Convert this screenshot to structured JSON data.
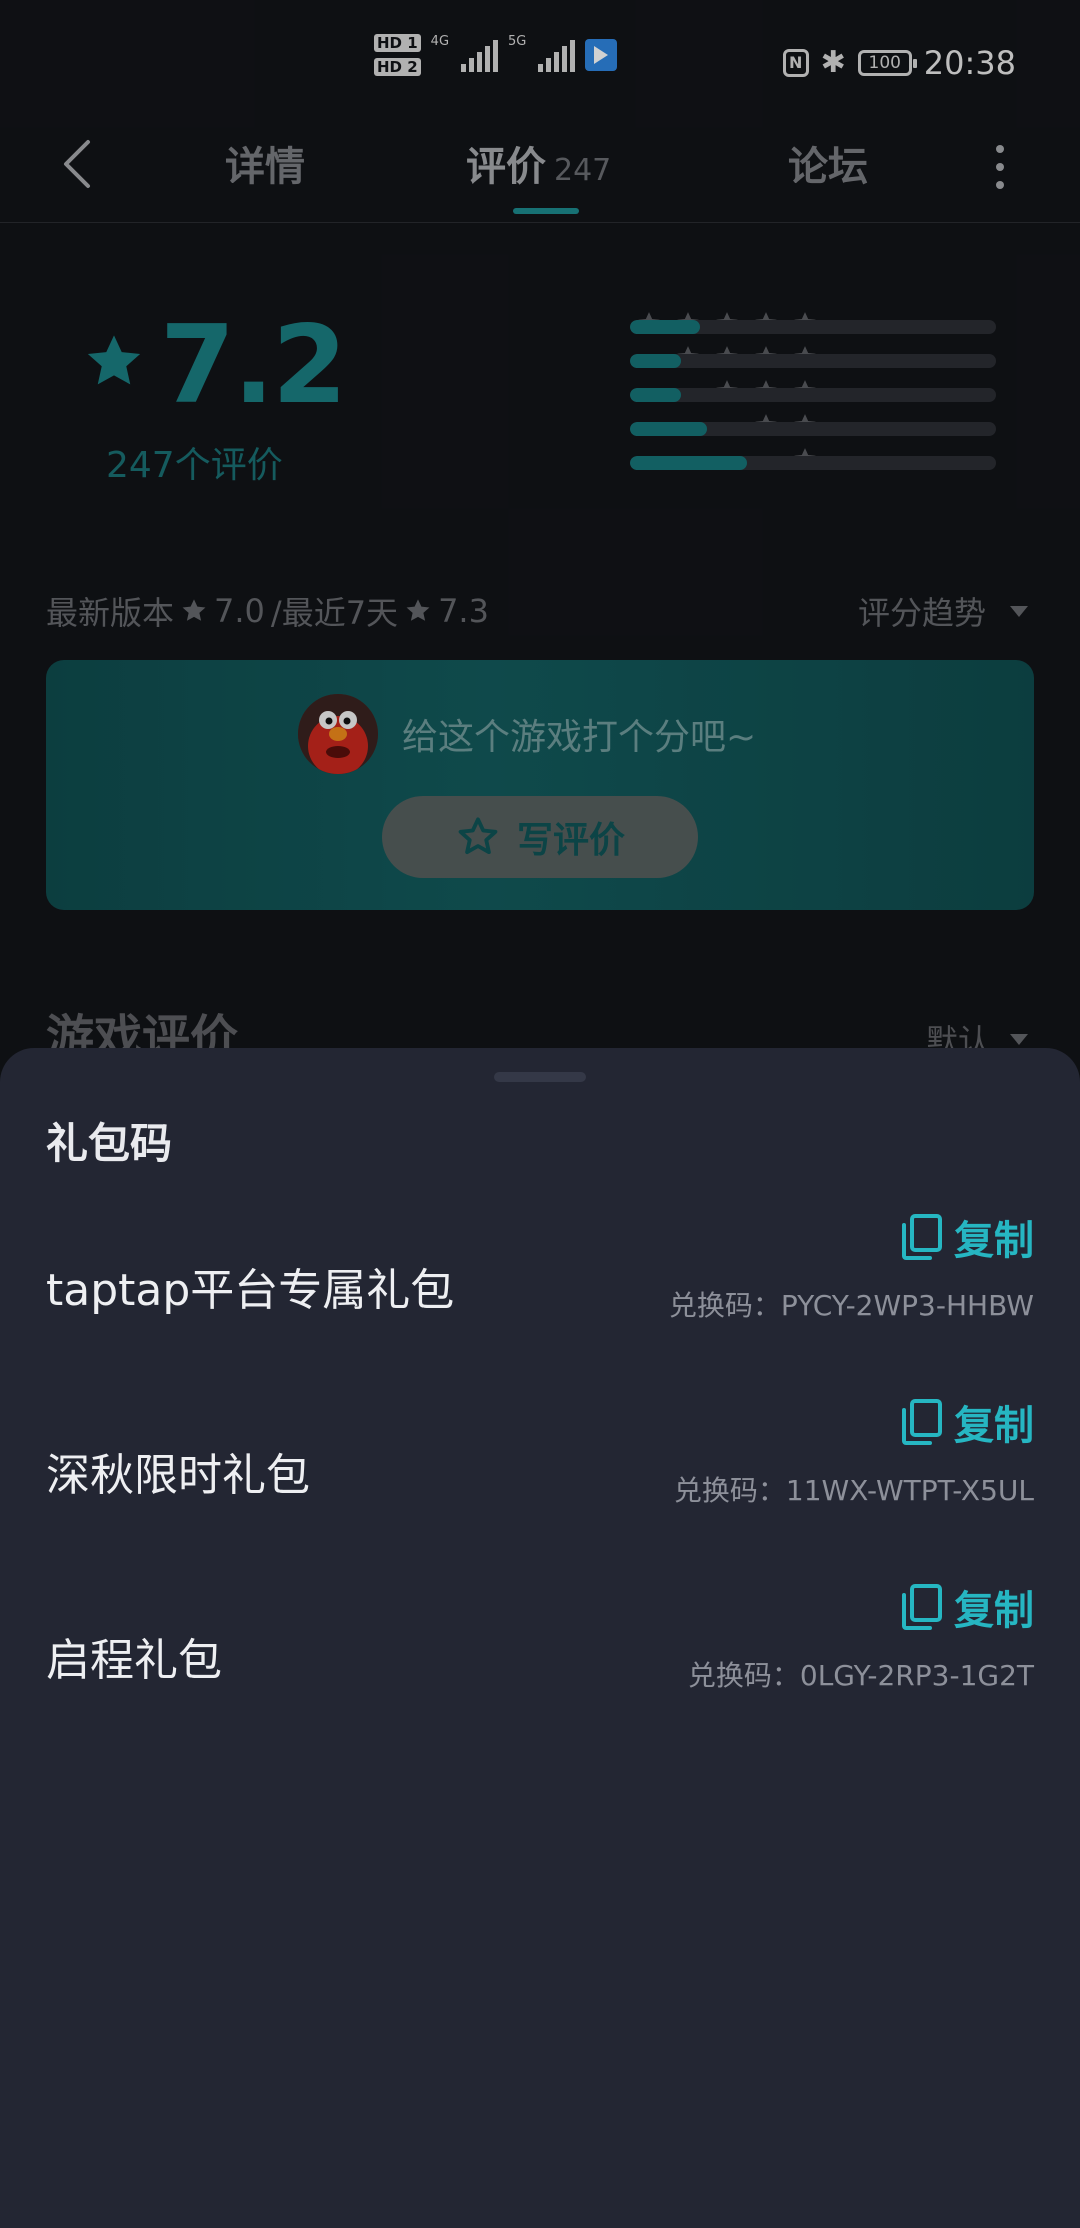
{
  "status_bar": {
    "sim1": "HD 1",
    "sim2": "HD 2",
    "net1": "4G",
    "net2": "5G",
    "nfc_icon": "N",
    "bluetooth_icon": "✱",
    "battery": "100",
    "time": "20:38"
  },
  "tabs": {
    "detail": "详情",
    "review": "评价",
    "review_count": "247",
    "forum": "论坛"
  },
  "rating": {
    "score": "7.2",
    "count_label": "247个评价",
    "distribution": [
      {
        "stars": 5,
        "fraction": 0.19
      },
      {
        "stars": 4,
        "fraction": 0.14
      },
      {
        "stars": 3,
        "fraction": 0.14
      },
      {
        "stars": 2,
        "fraction": 0.21
      },
      {
        "stars": 1,
        "fraction": 0.32
      }
    ]
  },
  "version": {
    "latest_label": "最新版本",
    "latest_score": "7.0",
    "recent_label": "/最近7天",
    "recent_score": "7.3",
    "trend_label": "评分趋势"
  },
  "write_card": {
    "prompt": "给这个游戏打个分吧~",
    "button": "写评价"
  },
  "reviews": {
    "title": "游戏评价",
    "sort": "默认"
  },
  "gift_sheet": {
    "title": "礼包码",
    "copy_label": "复制",
    "items": [
      {
        "name": "taptap平台专属礼包",
        "code": "兑换码：PYCY-2WP3-HHBW"
      },
      {
        "name": "深秋限时礼包",
        "code": "兑换码：11WX-WTPT-X5UL"
      },
      {
        "name": "启程礼包",
        "code": "兑换码：0LGY-2RP3-1G2T"
      }
    ]
  },
  "colors": {
    "accent": "#26b6c2",
    "teal_dim": "#1a7e82",
    "background": "#121418",
    "sheet": "#232633"
  }
}
